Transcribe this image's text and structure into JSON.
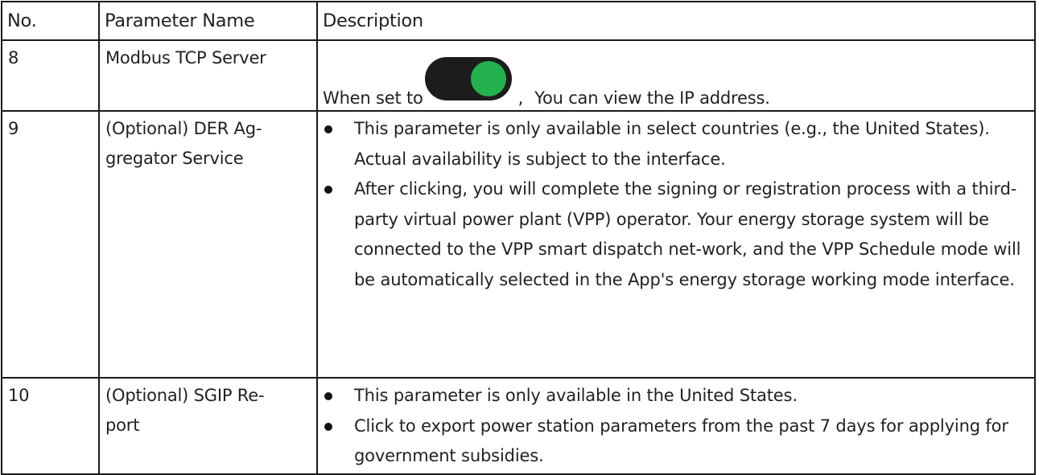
{
  "table": {
    "headers": {
      "no": "No.",
      "name": "Parameter Name",
      "description": "Description"
    },
    "rows": [
      {
        "no": "8",
        "name": "Modbus TCP Server",
        "desc_prefix": "When set to",
        "desc_comma": ",",
        "desc_suffix": "You can view the IP address.",
        "toggle_state": "on",
        "toggle_color": "#22b14c"
      },
      {
        "no": "9",
        "name": "(Optional) DER Ag-gregator Service",
        "name_line1": "(Optional) DER Ag-",
        "name_line2": "gregator Service",
        "bullets": [
          "This parameter is only available in select countries (e.g., the United States). Actual availability is subject to the interface.",
          "After clicking, you will complete the signing or registration process with a third-party virtual power plant (VPP) operator. Your energy storage system will be connected to the VPP smart dispatch net-work, and the VPP Schedule mode will be automatically selected in the App's energy storage working mode interface."
        ]
      },
      {
        "no": "10",
        "name": "(Optional) SGIP Re-port",
        "name_line1": "(Optional) SGIP Re-",
        "name_line2": "port",
        "bullets": [
          "This parameter is only available in the United States.",
          "Click to export power station parameters from the past 7 days for applying for government subsidies."
        ]
      }
    ]
  }
}
